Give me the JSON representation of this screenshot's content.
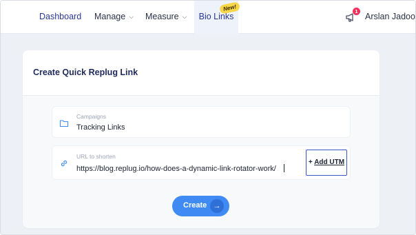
{
  "nav": {
    "dashboard": "Dashboard",
    "manage": "Manage",
    "measure": "Measure",
    "bio_links": "Bio Links",
    "new_badge": "New!",
    "notification_count": "1",
    "user_name": "Arslan Jadoon",
    "chevron": "⌄"
  },
  "card": {
    "title": "Create Quick Replug Link",
    "campaign": {
      "label": "Campaigns",
      "value": "Tracking Links",
      "icon": "folder-icon"
    },
    "url": {
      "label": "URL to shorten",
      "value": "https://blog.replug.io/how-does-a-dynamic-link-rotator-work/",
      "icon": "link-icon"
    },
    "add_utm": {
      "plus": "+",
      "label": "Add UTM"
    },
    "create": {
      "label": "Create",
      "arrow": "→"
    }
  },
  "colors": {
    "primary": "#3f8bf3",
    "nav_active": "#2a3894",
    "badge_yellow": "#f7d64a",
    "notification_red": "#f0325e"
  }
}
